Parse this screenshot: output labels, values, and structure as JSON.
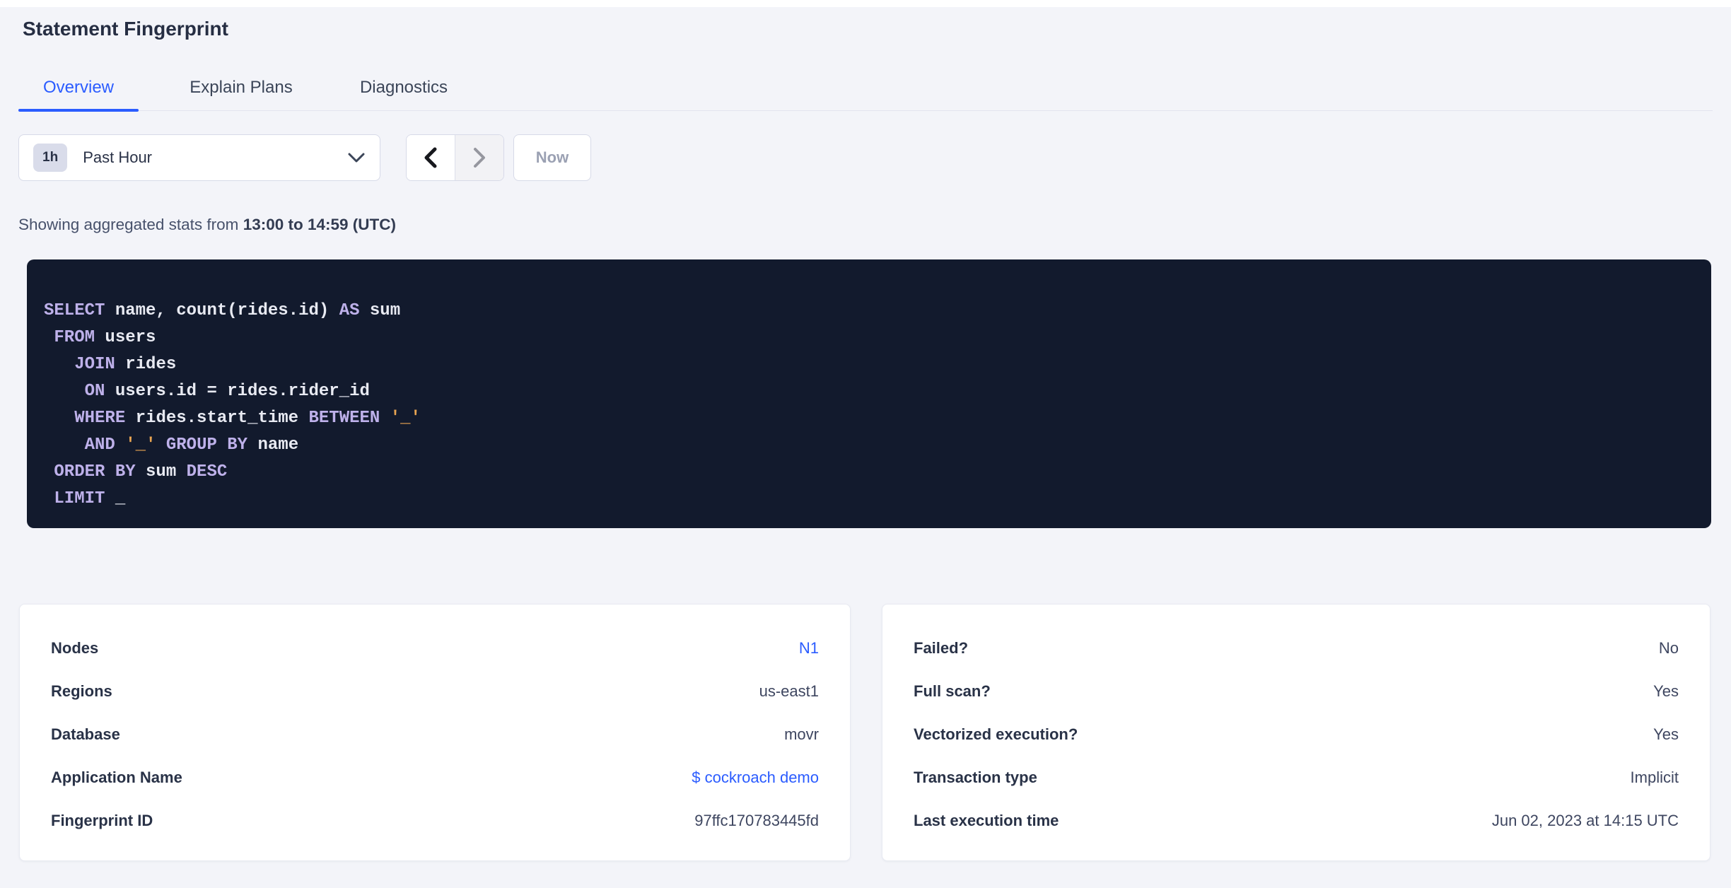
{
  "page": {
    "title": "Statement Fingerprint"
  },
  "tabs": [
    {
      "label": "Overview",
      "active": true
    },
    {
      "label": "Explain Plans",
      "active": false
    },
    {
      "label": "Diagnostics",
      "active": false
    }
  ],
  "time_picker": {
    "badge": "1h",
    "selected": "Past Hour",
    "now_label": "Now"
  },
  "stats_line": {
    "prefix": "Showing aggregated stats from ",
    "range": "13:00 to 14:59 (UTC)"
  },
  "sql": {
    "lines": [
      [
        {
          "t": "SELECT",
          "c": "kw"
        },
        {
          "t": " name, count(rides.id) ",
          "c": "pl"
        },
        {
          "t": "AS",
          "c": "kw"
        },
        {
          "t": " sum",
          "c": "pl"
        }
      ],
      [
        {
          "t": " ",
          "c": "pl"
        },
        {
          "t": "FROM",
          "c": "kw"
        },
        {
          "t": " users",
          "c": "pl"
        }
      ],
      [
        {
          "t": "   ",
          "c": "pl"
        },
        {
          "t": "JOIN",
          "c": "kw"
        },
        {
          "t": " rides",
          "c": "pl"
        }
      ],
      [
        {
          "t": "    ",
          "c": "pl"
        },
        {
          "t": "ON",
          "c": "kw"
        },
        {
          "t": " users.id = rides.rider_id",
          "c": "pl"
        }
      ],
      [
        {
          "t": "   ",
          "c": "pl"
        },
        {
          "t": "WHERE",
          "c": "kw"
        },
        {
          "t": " rides.start_time ",
          "c": "pl"
        },
        {
          "t": "BETWEEN",
          "c": "kw"
        },
        {
          "t": " ",
          "c": "pl"
        },
        {
          "t": "'_'",
          "c": "str"
        }
      ],
      [
        {
          "t": "    ",
          "c": "pl"
        },
        {
          "t": "AND",
          "c": "kw"
        },
        {
          "t": " ",
          "c": "pl"
        },
        {
          "t": "'_'",
          "c": "str"
        },
        {
          "t": " ",
          "c": "pl"
        },
        {
          "t": "GROUP BY",
          "c": "kw"
        },
        {
          "t": " name",
          "c": "pl"
        }
      ],
      [
        {
          "t": " ",
          "c": "pl"
        },
        {
          "t": "ORDER BY",
          "c": "kw"
        },
        {
          "t": " sum ",
          "c": "pl"
        },
        {
          "t": "DESC",
          "c": "kw"
        }
      ],
      [
        {
          "t": " ",
          "c": "pl"
        },
        {
          "t": "LIMIT",
          "c": "kw"
        },
        {
          "t": " _",
          "c": "pl"
        }
      ]
    ]
  },
  "cards": {
    "left": {
      "rows": [
        {
          "label": "Nodes",
          "value": "N1"
        },
        {
          "label": "Regions",
          "value": "us-east1"
        },
        {
          "label": "Database",
          "value": "movr"
        },
        {
          "label": "Application Name",
          "value": "$ cockroach demo"
        },
        {
          "label": "Fingerprint ID",
          "value": "97ffc170783445fd"
        }
      ]
    },
    "right": {
      "rows": [
        {
          "label": "Failed?",
          "value": "No"
        },
        {
          "label": "Full scan?",
          "value": "Yes"
        },
        {
          "label": "Vectorized execution?",
          "value": "Yes"
        },
        {
          "label": "Transaction type",
          "value": "Implicit"
        },
        {
          "label": "Last execution time",
          "value": "Jun 02, 2023 at 14:15 UTC"
        }
      ]
    }
  },
  "colors": {
    "accent_blue": "#2b5cff",
    "sql_background": "#121a2d",
    "sql_keyword": "#beb1ea",
    "sql_plain": "#e8eaf2",
    "sql_literal": "#e8a452",
    "page_background": "#f3f4f9"
  }
}
